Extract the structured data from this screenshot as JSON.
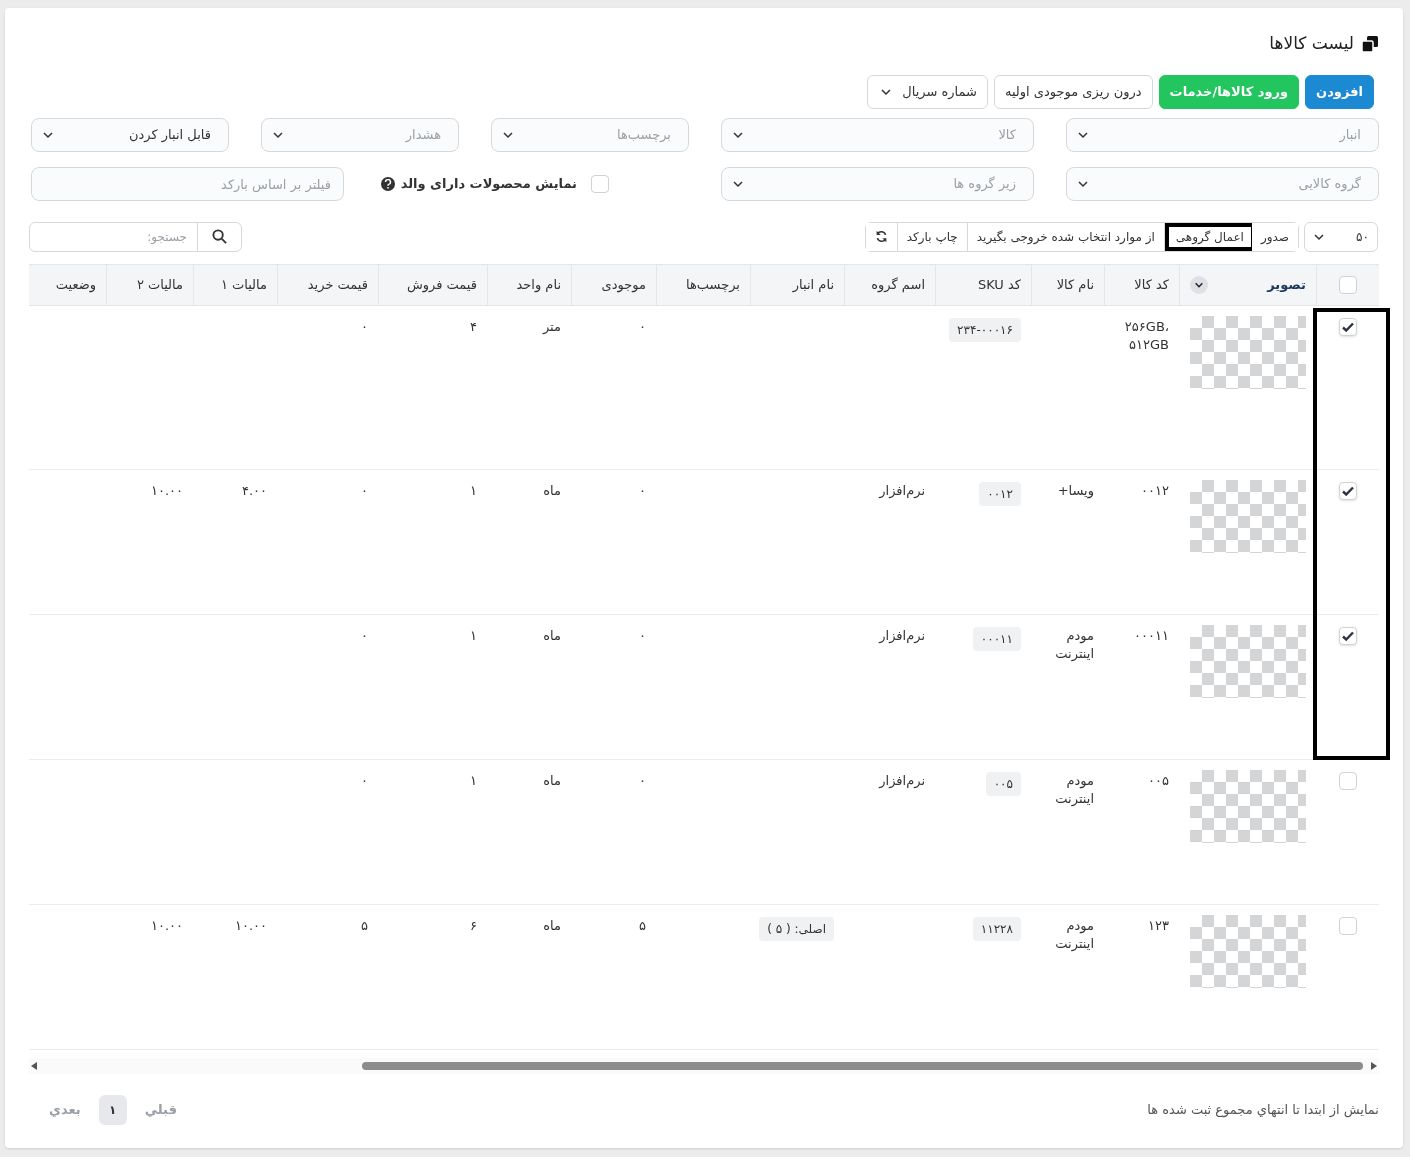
{
  "page": {
    "title": "لیست کالاها"
  },
  "actions": [
    {
      "label": "افزودن",
      "kind": "primary"
    },
    {
      "label": "ورود کالاها/خدمات",
      "kind": "success"
    },
    {
      "label": "درون ریزی موجودی اولیه",
      "kind": "outline"
    },
    {
      "label": "شماره سریال",
      "kind": "dropdown"
    }
  ],
  "filter_rows": [
    [
      {
        "kind": "select",
        "placeholder": "انبار"
      },
      {
        "kind": "select",
        "placeholder": "کالا"
      },
      {
        "kind": "select",
        "placeholder": "برچسب‌ها"
      },
      {
        "kind": "select",
        "placeholder": "هشدار"
      },
      {
        "kind": "select",
        "value": "قابل انبار کردن"
      }
    ],
    [
      {
        "kind": "select",
        "placeholder": "گروه کالایی"
      },
      {
        "kind": "select",
        "placeholder": "زیر گروه ها"
      },
      {
        "kind": "checkbox",
        "label": "نمایش محصولات دارای والد",
        "checked": false
      },
      {
        "kind": "input",
        "placeholder": "فیلتر بر اساس بارکد"
      }
    ]
  ],
  "toolbar": {
    "page_size": "۵۰",
    "buttons": [
      {
        "kind": "text",
        "label": "صدور",
        "highlighted": false
      },
      {
        "kind": "text",
        "label": "اعمال گروهی",
        "highlighted": true
      },
      {
        "kind": "text",
        "label": "از موارد انتخاب شده خروجی بگیرید",
        "highlighted": false
      },
      {
        "kind": "text",
        "label": "چاپ بارکد",
        "highlighted": false
      },
      {
        "kind": "refresh",
        "highlighted": false
      }
    ],
    "search": {
      "placeholder": "جستجو:"
    }
  },
  "table": {
    "columns": [
      "تصویر",
      "کد کالا",
      "نام کالا",
      "کد SKU",
      "اسم گروه",
      "نام انبار",
      "برچسب‌ها",
      "موجودی",
      "نام واحد",
      "قیمت فروش",
      "قیمت خرید",
      "مالیات ۱",
      "مالیات ۲",
      "وضعیت"
    ],
    "all_selected": false,
    "rows": [
      {
        "selected": true,
        "highlighted": true,
        "code": "۲۵۶GB، ۵۱۲GB",
        "sku": "۲۳۴-۰۰۰۱۶",
        "stock": "۰",
        "unit": "متر",
        "sale_price": "۴",
        "buy_price": "۰"
      },
      {
        "selected": true,
        "highlighted": true,
        "code": "۰۰۱۲",
        "name": "ویسا+",
        "sku": "۰۰۱۲",
        "group": "نرم‌افزار",
        "stock": "۰",
        "unit": "ماه",
        "sale_price": "۱",
        "buy_price": "۰",
        "tax_1": "۴.۰۰",
        "tax_2": "۱۰.۰۰"
      },
      {
        "selected": true,
        "highlighted": true,
        "code": "۰۰۰۱۱",
        "name": "مودم اینترنت",
        "sku": "۰۰۰۱۱",
        "group": "نرم‌افزار",
        "stock": "۰",
        "unit": "ماه",
        "sale_price": "۱",
        "buy_price": "۰"
      },
      {
        "selected": false,
        "highlighted": false,
        "code": "۰۰۵",
        "name": "مودم اینترنت",
        "sku": "۰۰۵",
        "group": "نرم‌افزار",
        "stock": "۰",
        "unit": "ماه",
        "sale_price": "۱",
        "buy_price": "۰"
      },
      {
        "selected": false,
        "highlighted": false,
        "code": "۱۲۳",
        "name": "مودم اینترنت",
        "sku": "۱۱۲۲۸",
        "warehouse": "اصلی: ( ۵ )",
        "stock": "۵",
        "unit": "ماه",
        "sale_price": "۶",
        "buy_price": "۵",
        "tax_1": "۱۰.۰۰",
        "tax_2": "۱۰.۰۰"
      }
    ]
  },
  "footer": {
    "info": "نمایش از ابتدا تا انتهاي مجموع ثبت شده ها",
    "prev": "قبلي",
    "pages": [
      {
        "label": "۱",
        "selected": true
      }
    ],
    "next": "بعدي"
  }
}
